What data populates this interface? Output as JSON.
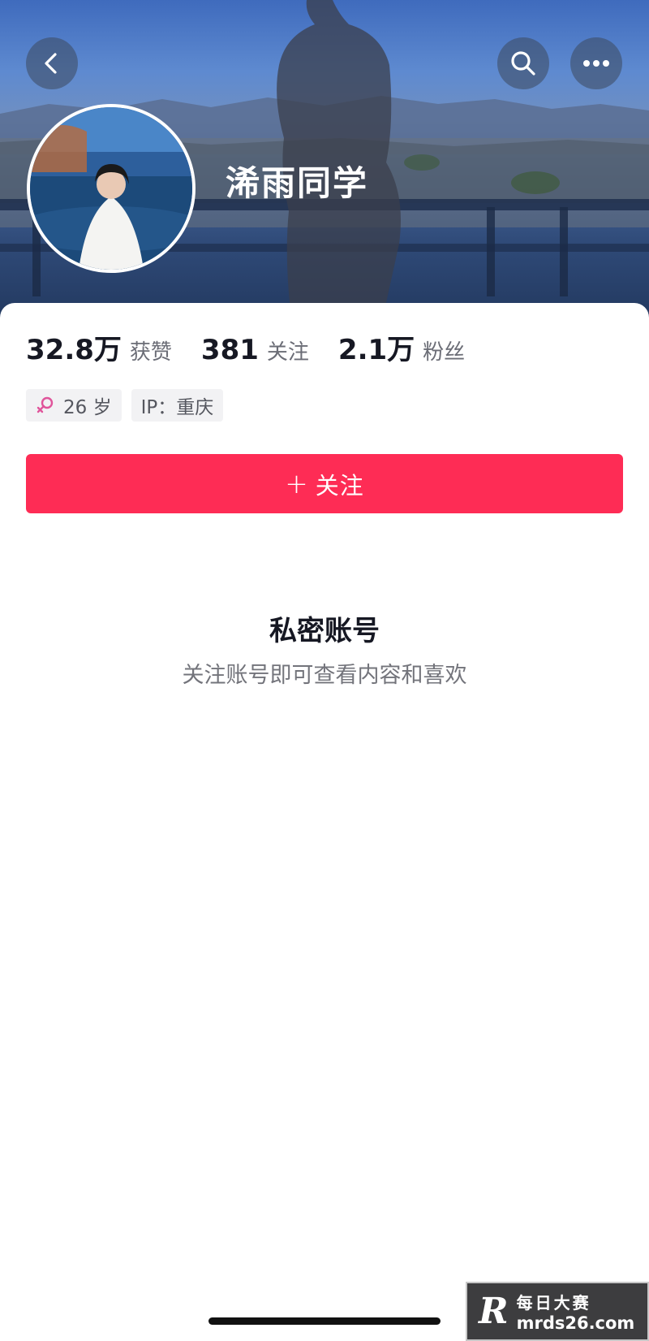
{
  "header": {
    "back_icon": "chevron-left-icon",
    "search_icon": "search-icon",
    "more_icon": "more-horizontal-icon"
  },
  "profile": {
    "nickname": "浠雨同学",
    "avatar_icon": "avatar-photo"
  },
  "stats": [
    {
      "value": "32.8万",
      "label": "获赞"
    },
    {
      "value": "381",
      "label": "关注"
    },
    {
      "value": "2.1万",
      "label": "粉丝"
    }
  ],
  "tags": {
    "gender_icon": "female-gender-icon",
    "age": "26 岁",
    "ip": "IP：重庆"
  },
  "follow_button": {
    "plus": "+",
    "label": "关注"
  },
  "private": {
    "title": "私密账号",
    "subtitle": "关注账号即可查看内容和喜欢"
  },
  "watermark": {
    "logo": "R",
    "line1": "每日大赛",
    "line2": "mrds26.com"
  },
  "colors": {
    "accent": "#fe2c55",
    "gender": "#e0559b"
  }
}
